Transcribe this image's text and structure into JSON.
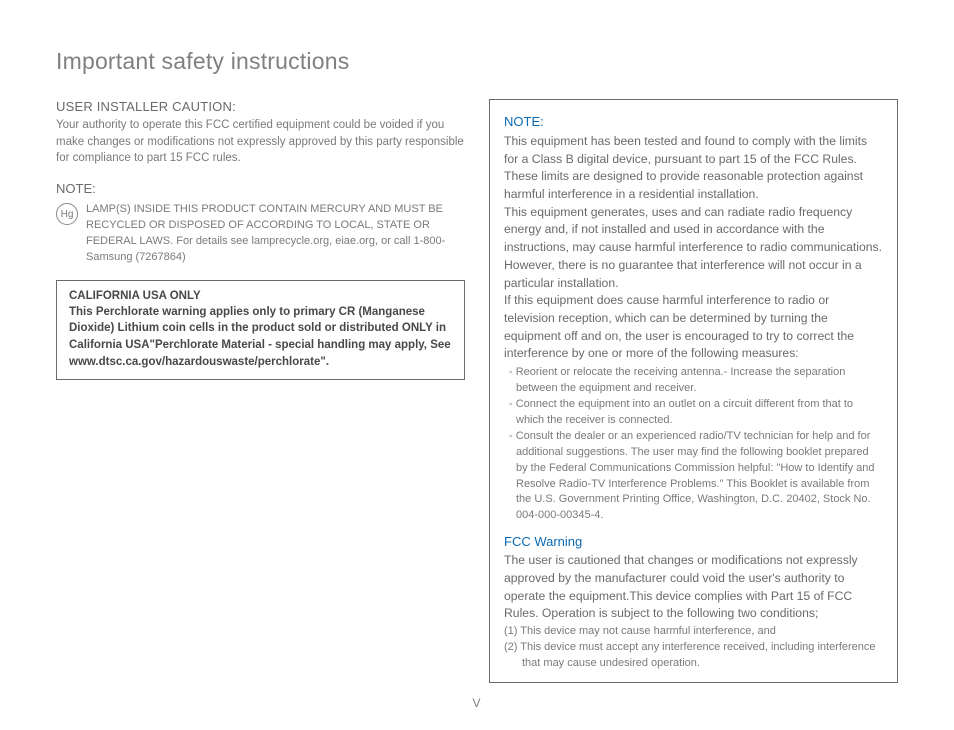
{
  "title": "Important safety instructions",
  "left": {
    "installer_heading": "USER INSTALLER CAUTION:",
    "installer_body": "Your authority to operate this FCC certified equipment could be voided if you make changes or modifications not expressly approved by this party responsible for compliance to part 15 FCC rules.",
    "note_label": "NOTE:",
    "hg_symbol": "Hg",
    "hg_text": "LAMP(S) INSIDE THIS PRODUCT CONTAIN MERCURY AND MUST BE RECYCLED OR DISPOSED OF ACCORDING TO LOCAL, STATE OR FEDERAL LAWS. For details see lamprecycle.org, eiae.org, or call 1-800-Samsung (7267864)",
    "california_title": "CALIFORNIA USA ONLY",
    "california_body": "This Perchlorate warning applies only to primary CR (Manganese Dioxide) Lithium coin cells in the product sold or distributed ONLY in California USA\"Perchlorate Material - special handling may apply, See www.dtsc.ca.gov/hazardouswaste/perchlorate\"."
  },
  "right": {
    "note_label": "NOTE:",
    "para1": "This equipment has been tested and found to comply with the limits for a Class B digital device, pursuant to part 15 of the FCC Rules.",
    "para2": "These limits are designed to provide reasonable protection against harmful interference in a residential installation.",
    "para3": "This equipment generates, uses and can radiate radio frequency energy and, if not installed and used in accordance with the instructions, may cause harmful interference to radio communications. However, there is no guarantee that interference will not occur in a particular installation.",
    "para4": "If this equipment does cause harmful interference to radio or television reception, which can be determined by turning the equipment off and on, the user is encouraged to try to correct the interference by one or more of the following measures:",
    "bullets": [
      "- Reorient or relocate the receiving antenna.- Increase the separation between the equipment and receiver.",
      "- Connect the equipment into an outlet on a circuit different from that to which the receiver is connected.",
      "- Consult the dealer or an experienced radio/TV technician for help and for additional suggestions. The user may find the following booklet prepared by the Federal Communications Commission helpful: \"How to Identify and Resolve Radio-TV Interference Problems.\" This Booklet is available from the U.S. Government Printing Office, Washington, D.C. 20402, Stock No. 004-000-00345-4."
    ],
    "fcc_heading": "FCC Warning",
    "fcc_body": "The user is cautioned that changes or modifications not expressly approved by the manufacturer could void the user's authority to operate the equipment.This device complies with Part 15 of FCC Rules. Operation is subject to the following two conditions;",
    "conditions": [
      "(1) This device may not cause harmful interference, and",
      "(2) This device must accept any interference received, including interference that may cause undesired operation."
    ]
  },
  "page_number": "V"
}
